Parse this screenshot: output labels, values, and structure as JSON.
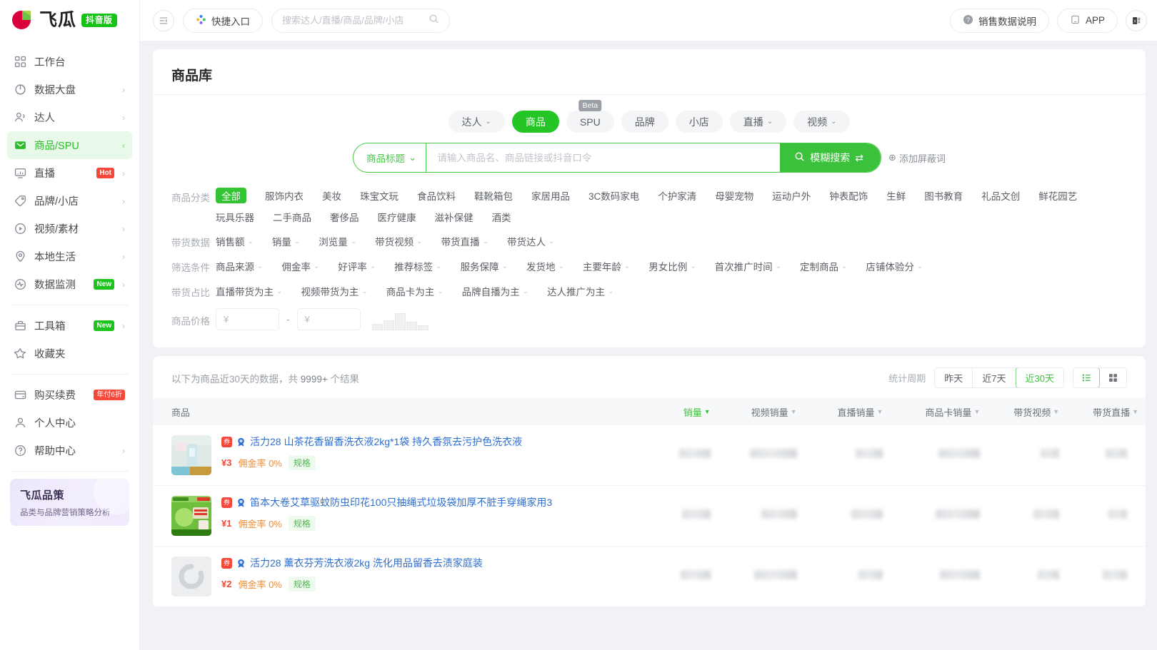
{
  "brand": {
    "name": "飞瓜",
    "badge": "抖音版"
  },
  "sidebar": {
    "items": [
      {
        "label": "工作台",
        "icon": "dashboard-icon",
        "chevron": "",
        "tag": ""
      },
      {
        "label": "数据大盘",
        "icon": "pie-chart-icon",
        "chevron": "›",
        "tag": ""
      },
      {
        "label": "达人",
        "icon": "users-icon",
        "chevron": "›",
        "tag": ""
      },
      {
        "label": "商品/SPU",
        "icon": "box-icon",
        "chevron": "‹",
        "tag": "",
        "active": true
      },
      {
        "label": "直播",
        "icon": "monitor-icon",
        "chevron": "›",
        "tag": "Hot",
        "tag_type": "hot"
      },
      {
        "label": "品牌/小店",
        "icon": "tag-icon",
        "chevron": "›",
        "tag": ""
      },
      {
        "label": "视频/素材",
        "icon": "play-circle-icon",
        "chevron": "›",
        "tag": ""
      },
      {
        "label": "本地生活",
        "icon": "location-pin-icon",
        "chevron": "›",
        "tag": ""
      },
      {
        "label": "数据监测",
        "icon": "pulse-icon",
        "chevron": "›",
        "tag": "New",
        "tag_type": "new"
      }
    ],
    "items2": [
      {
        "label": "工具箱",
        "icon": "toolbox-icon",
        "chevron": "›",
        "tag": "New",
        "tag_type": "new"
      },
      {
        "label": "收藏夹",
        "icon": "star-icon",
        "chevron": "",
        "tag": ""
      }
    ],
    "items3": [
      {
        "label": "购买续费",
        "icon": "card-icon",
        "chevron": "",
        "tag": "年付6折",
        "tag_type": "disc"
      },
      {
        "label": "个人中心",
        "icon": "user-icon",
        "chevron": "",
        "tag": ""
      },
      {
        "label": "帮助中心",
        "icon": "question-circle-icon",
        "chevron": "›",
        "tag": ""
      }
    ],
    "promo": {
      "title": "飞瓜品策",
      "subtitle": "品类与品牌营销策略分析"
    }
  },
  "topbar": {
    "collapse_icon": "collapse-sidebar-icon",
    "quick_entry": "快捷入口",
    "search_placeholder": "搜索达人/直播/商品/品牌/小店",
    "search_value": "",
    "sales_help": "销售数据说明",
    "app": "APP",
    "excel_icon": "excel-export-icon"
  },
  "page": {
    "title": "商品库"
  },
  "tabs": [
    {
      "label": "达人",
      "caret": true,
      "active": false
    },
    {
      "label": "商品",
      "caret": false,
      "active": true
    },
    {
      "label": "SPU",
      "caret": false,
      "active": false,
      "beta": "Beta"
    },
    {
      "label": "品牌",
      "caret": false,
      "active": false
    },
    {
      "label": "小店",
      "caret": false,
      "active": false
    },
    {
      "label": "直播",
      "caret": true,
      "active": false
    },
    {
      "label": "视频",
      "caret": true,
      "active": false
    }
  ],
  "search": {
    "select_label": "商品标题",
    "placeholder": "请输入商品名、商品链接或抖音口令",
    "value": "",
    "submit_label": "模糊搜索",
    "swap_icon": "swap-icon",
    "add_exclude": "添加屏蔽词"
  },
  "filters": [
    {
      "label": "商品分类",
      "items": [
        {
          "text": "全部",
          "selected": true
        },
        {
          "text": "服饰内衣"
        },
        {
          "text": "美妆"
        },
        {
          "text": "珠宝文玩"
        },
        {
          "text": "食品饮料"
        },
        {
          "text": "鞋靴箱包"
        },
        {
          "text": "家居用品"
        },
        {
          "text": "3C数码家电"
        },
        {
          "text": "个护家清"
        },
        {
          "text": "母婴宠物"
        },
        {
          "text": "运动户外"
        },
        {
          "text": "钟表配饰"
        },
        {
          "text": "生鲜"
        },
        {
          "text": "图书教育"
        },
        {
          "text": "礼品文创"
        },
        {
          "text": "鲜花园艺"
        },
        {
          "text": "玩具乐器"
        },
        {
          "text": "二手商品"
        },
        {
          "text": "奢侈品"
        },
        {
          "text": "医疗健康"
        },
        {
          "text": "滋补保健"
        },
        {
          "text": "酒类"
        }
      ]
    },
    {
      "label": "带货数据",
      "items": [
        {
          "text": "销售额",
          "caret": true
        },
        {
          "text": "销量",
          "caret": true
        },
        {
          "text": "浏览量",
          "caret": true
        },
        {
          "text": "带货视频",
          "caret": true
        },
        {
          "text": "带货直播",
          "caret": true
        },
        {
          "text": "带货达人",
          "caret": true
        }
      ]
    },
    {
      "label": "筛选条件",
      "items": [
        {
          "text": "商品来源",
          "caret": true
        },
        {
          "text": "佣金率",
          "caret": true
        },
        {
          "text": "好评率",
          "caret": true
        },
        {
          "text": "推荐标签",
          "caret": true
        },
        {
          "text": "服务保障",
          "caret": true
        },
        {
          "text": "发货地",
          "caret": true
        },
        {
          "text": "主要年龄",
          "caret": true
        },
        {
          "text": "男女比例",
          "caret": true
        },
        {
          "text": "首次推广时间",
          "caret": true
        },
        {
          "text": "定制商品",
          "caret": true
        },
        {
          "text": "店铺体验分",
          "caret": true
        }
      ]
    },
    {
      "label": "带货占比",
      "items": [
        {
          "text": "直播带货为主",
          "caret": true
        },
        {
          "text": "视频带货为主",
          "caret": true
        },
        {
          "text": "商品卡为主",
          "caret": true
        },
        {
          "text": "品牌自播为主",
          "caret": true
        },
        {
          "text": "达人推广为主",
          "caret": true
        }
      ]
    }
  ],
  "price": {
    "label": "商品价格",
    "min_placeholder": "¥",
    "max_placeholder": "¥",
    "min_value": "",
    "max_value": "",
    "dash": "-",
    "histogram": [
      30,
      45,
      78,
      38,
      22
    ]
  },
  "results": {
    "note_prefix": "以下为商品近30天的数据，共",
    "count": "9999+",
    "note_suffix": "个结果",
    "period_label": "统计周期",
    "periods": [
      {
        "label": "昨天",
        "on": false
      },
      {
        "label": "近7天",
        "on": false
      },
      {
        "label": "近30天",
        "on": true
      }
    ],
    "views": [
      {
        "icon": "list-view-icon",
        "on": true
      },
      {
        "icon": "grid-view-icon",
        "on": false
      }
    ]
  },
  "table": {
    "columns": [
      {
        "label": "商品",
        "sortable": false,
        "sorted": false
      },
      {
        "label": "销量",
        "sortable": true,
        "sorted": true
      },
      {
        "label": "视频销量",
        "sortable": true,
        "sorted": false
      },
      {
        "label": "直播销量",
        "sortable": true,
        "sorted": false
      },
      {
        "label": "商品卡销量",
        "sortable": true,
        "sorted": false
      },
      {
        "label": "带货视频",
        "sortable": true,
        "sorted": false
      },
      {
        "label": "带货直播",
        "sortable": true,
        "sorted": false
      }
    ],
    "rows": [
      {
        "title": "活力28 山茶花香留香洗衣液2kg*1袋 持久香氛去污护色洗衣液",
        "price": "¥3",
        "commission": "佣金率 0%",
        "spec": "规格",
        "badge_square": "券",
        "badge_ribbon": "rosette-icon",
        "thumb": "product-thumbnail",
        "metrics": [
          "",
          "",
          "",
          "",
          "",
          ""
        ]
      },
      {
        "title": "笛本大卷艾草驱蚊防虫印花100只抽绳式垃圾袋加厚不脏手穿绳家用3",
        "price": "¥1",
        "commission": "佣金率 0%",
        "spec": "规格",
        "badge_square": "券",
        "badge_ribbon": "rosette-icon",
        "thumb": "product-thumbnail",
        "metrics": [
          "",
          "",
          "",
          "",
          "",
          ""
        ]
      },
      {
        "title": "活力28 薰衣芬芳洗衣液2kg 洗化用品留香去渍家庭装",
        "price": "¥2",
        "commission": "佣金率 0%",
        "spec": "规格",
        "badge_square": "券",
        "badge_ribbon": "rosette-icon",
        "thumb": "product-thumbnail-loading",
        "metrics": [
          "",
          "",
          "",
          "",
          "",
          ""
        ]
      }
    ]
  },
  "colors": {
    "accent": "#25c525",
    "accent_dark": "#3cc13c",
    "red": "#f5483b",
    "orange": "#f08b34",
    "link": "#2f6fd0"
  }
}
